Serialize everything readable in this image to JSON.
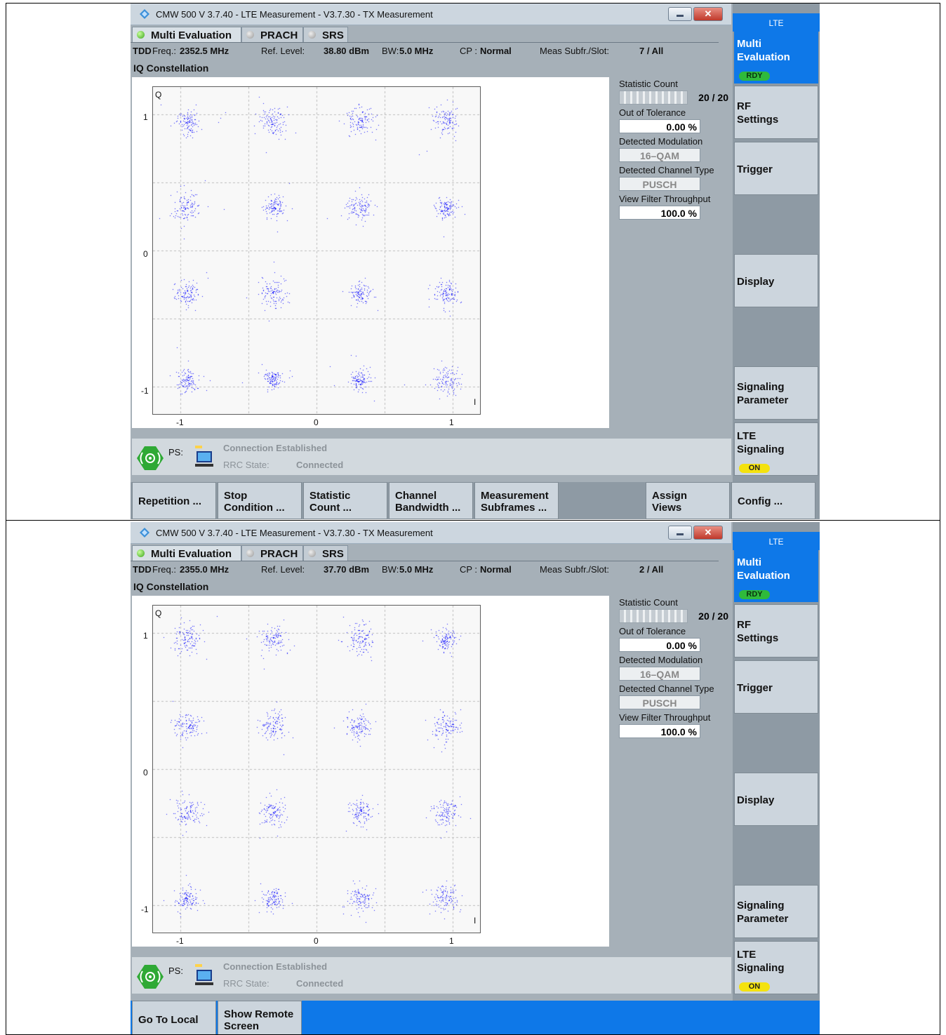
{
  "screens": [
    {
      "window_title": "CMW 500 V 3.7.40 - LTE Measurement  - V3.7.30 - TX Measurement",
      "tabs": [
        "Multi Evaluation",
        "PRACH",
        "SRS"
      ],
      "info": {
        "mode": "TDD",
        "freq_label": "Freq.:",
        "freq_value": "2352.5 MHz",
        "ref_label": "Ref. Level:",
        "ref_value": "38.80 dBm",
        "bw_label": "BW:",
        "bw_value": "5.0 MHz",
        "cp_label": "CP :",
        "cp_value": "Normal",
        "subfr_label": "Meas Subfr./Slot:",
        "subfr_value": "7  / All"
      },
      "view_title": "IQ Constellation",
      "plot": {
        "y_axis_label": "Q",
        "x_axis_label": "I",
        "y_ticks": [
          "1",
          "0",
          "-1"
        ],
        "x_ticks": [
          "-1",
          "0",
          "1"
        ]
      },
      "stats": {
        "statistic_count_label": "Statistic Count",
        "statistic_count_value": "20 / 20",
        "statistic_progress": 1.0,
        "out_of_tolerance_label": "Out of Tolerance",
        "out_of_tolerance_value": "0.00  %",
        "detected_modulation_label": "Detected Modulation",
        "detected_modulation_value": "16–QAM",
        "detected_channel_type_label": "Detected Channel Type",
        "detected_channel_type_value": "PUSCH",
        "view_filter_label": "View Filter Throughput",
        "view_filter_value": "100.0  %"
      },
      "status": {
        "ps": "PS:",
        "connection": "Connection Established",
        "rrc_label": "RRC State:",
        "rrc_value": "Connected"
      },
      "softkeys": {
        "header": "LTE",
        "multi_evaluation": "Multi\nEvaluation",
        "rdy": "RDY",
        "rf_settings": "RF\nSettings",
        "trigger": "Trigger",
        "display": "Display",
        "signaling_parameter": "Signaling\nParameter",
        "lte_signaling": "LTE\nSignaling",
        "on": "ON"
      },
      "hotkeys": {
        "repetition": "Repetition ...",
        "stop_condition": "Stop\nCondition ...",
        "statistic_count": "Statistic\nCount ...",
        "channel_bandwidth": "Channel\nBandwidth ...",
        "measurement_subframes": "Measurement\nSubframes ...",
        "assign_views": "Assign\nViews",
        "config": "Config ..."
      }
    },
    {
      "window_title": "CMW 500 V 3.7.40 - LTE Measurement  - V3.7.30 - TX Measurement",
      "tabs": [
        "Multi Evaluation",
        "PRACH",
        "SRS"
      ],
      "info": {
        "mode": "TDD",
        "freq_label": "Freq.:",
        "freq_value": "2355.0 MHz",
        "ref_label": "Ref. Level:",
        "ref_value": "37.70 dBm",
        "bw_label": "BW:",
        "bw_value": "5.0 MHz",
        "cp_label": "CP :",
        "cp_value": "Normal",
        "subfr_label": "Meas Subfr./Slot:",
        "subfr_value": "2  / All"
      },
      "view_title": "IQ Constellation",
      "plot": {
        "y_axis_label": "Q",
        "x_axis_label": "I",
        "y_ticks": [
          "1",
          "0",
          "-1"
        ],
        "x_ticks": [
          "-1",
          "0",
          "1"
        ]
      },
      "stats": {
        "statistic_count_label": "Statistic Count",
        "statistic_count_value": "20 / 20",
        "statistic_progress": 1.0,
        "out_of_tolerance_label": "Out of Tolerance",
        "out_of_tolerance_value": "0.00  %",
        "detected_modulation_label": "Detected Modulation",
        "detected_modulation_value": "16–QAM",
        "detected_channel_type_label": "Detected Channel Type",
        "detected_channel_type_value": "PUSCH",
        "view_filter_label": "View Filter Throughput",
        "view_filter_value": "100.0  %"
      },
      "status": {
        "ps": "PS:",
        "connection": "Connection Established",
        "rrc_label": "RRC State:",
        "rrc_value": "Connected"
      },
      "softkeys": {
        "header": "LTE",
        "multi_evaluation": "Multi\nEvaluation",
        "rdy": "RDY",
        "rf_settings": "RF\nSettings",
        "trigger": "Trigger",
        "display": "Display",
        "signaling_parameter": "Signaling\nParameter",
        "lte_signaling": "LTE\nSignaling",
        "on": "ON"
      },
      "hotkeys": {
        "go_to_local": "Go To Local",
        "show_remote_screen": "Show Remote\nScreen"
      }
    }
  ],
  "colors": {
    "accent": "#0e78e8",
    "constellation_point": "#1a1aff",
    "rdy": "#2fba3b",
    "on": "#f4e20e"
  },
  "constellation": {
    "modulation": "16-QAM",
    "levels": [
      -0.949,
      -0.316,
      0.316,
      0.949
    ]
  }
}
